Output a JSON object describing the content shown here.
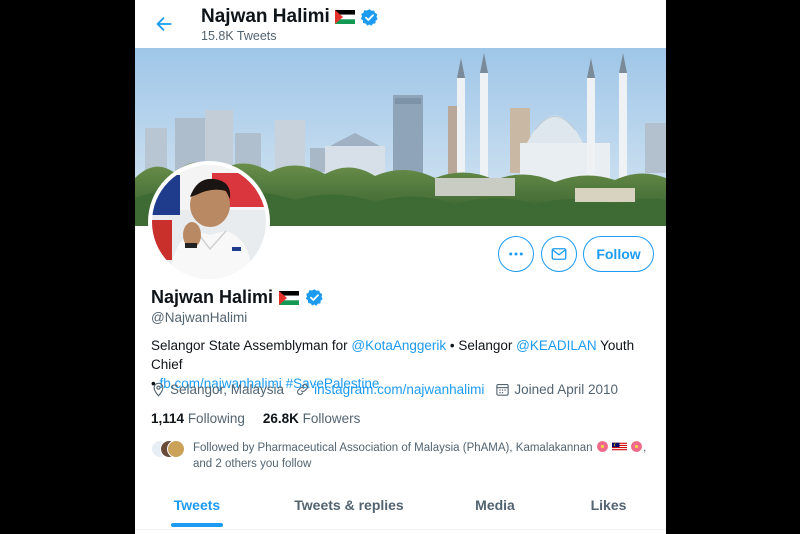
{
  "header": {
    "title": "Najwan Halimi",
    "tweet_count": "15.8K Tweets"
  },
  "profile": {
    "name": "Najwan Halimi",
    "handle": "@NajwanHalimi",
    "bio_parts": {
      "p1": "Selangor State Assemblyman for ",
      "p2": "@KotaAnggerik",
      "p3": " • Selangor ",
      "p4": "@KEADILAN",
      "p5": " Youth Chief",
      "p6": "• ",
      "p7": "fb.com/najwanhalimi",
      "p8": " ",
      "p9": "#SavePalestine"
    },
    "location": "Selangor, Malaysia",
    "website": "instagram.com/najwanhalimi",
    "joined": "Joined April 2010",
    "following_count": "1,114",
    "following_label": "Following",
    "followers_count": "26.8K",
    "followers_label": "Followers",
    "followed_by_line1": "Followed by Pharmaceutical Association of Malaysia (PhAMA), Kamalakannan",
    "followed_by_line2": "and 2 others you follow"
  },
  "actions": {
    "more_icon": "more-icon",
    "message_icon": "mail-icon",
    "follow_label": "Follow"
  },
  "tabs": [
    {
      "label": "Tweets",
      "active": true
    },
    {
      "label": "Tweets & replies",
      "active": false
    },
    {
      "label": "Media",
      "active": false
    },
    {
      "label": "Likes",
      "active": false
    }
  ],
  "colors": {
    "accent": "#1d9bf0",
    "text_primary": "#0f1419",
    "text_secondary": "#536471"
  }
}
